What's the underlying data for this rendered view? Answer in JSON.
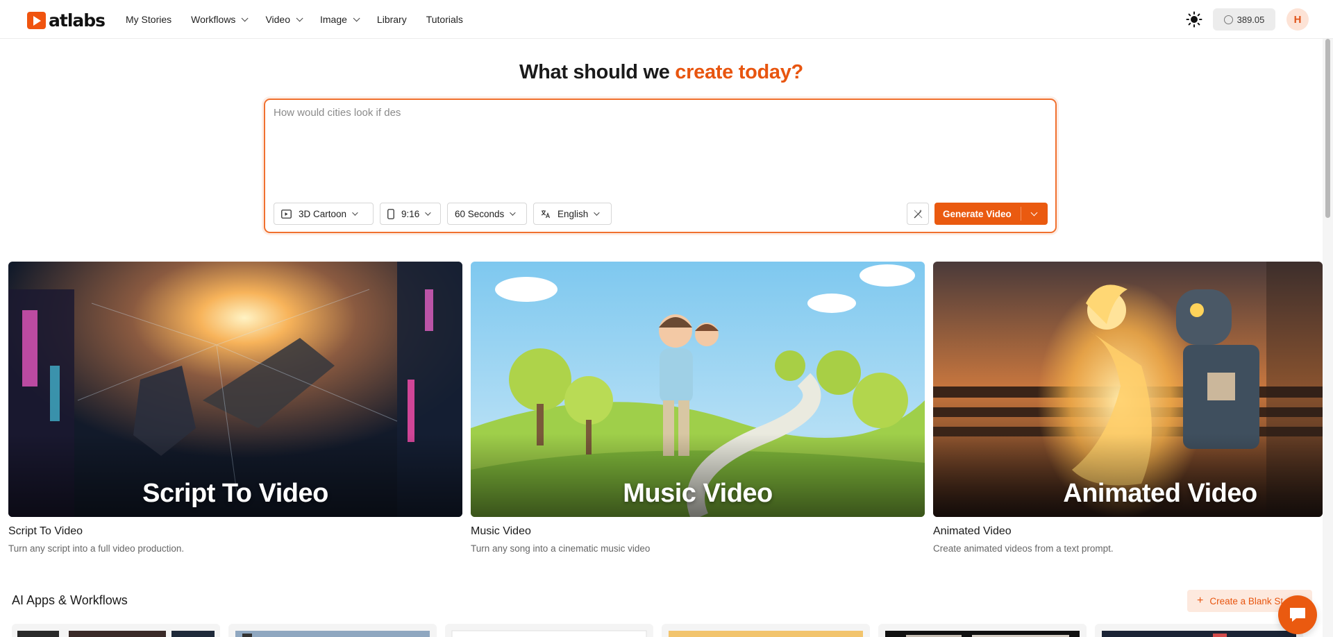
{
  "app": {
    "logo_text": "atlabs"
  },
  "nav": {
    "items": [
      {
        "label": "My Stories",
        "has_dropdown": false
      },
      {
        "label": "Workflows",
        "has_dropdown": true
      },
      {
        "label": "Video",
        "has_dropdown": true
      },
      {
        "label": "Image",
        "has_dropdown": true
      },
      {
        "label": "Library",
        "has_dropdown": false
      },
      {
        "label": "Tutorials",
        "has_dropdown": false
      }
    ]
  },
  "header": {
    "credits": "389.05",
    "avatar_initial": "H",
    "theme_icon": "sun-icon"
  },
  "hero": {
    "title_plain": "What should we ",
    "title_accent": "create today?",
    "prompt_placeholder": "How would cities look if des",
    "style_label": "3D Cartoon",
    "ratio_label": "9:16",
    "duration_label": "60 Seconds",
    "language_label": "English",
    "generate_label": "Generate Video"
  },
  "cards": [
    {
      "image_title": "Script To Video",
      "title": "Script To Video",
      "description": "Turn any script into a full video production."
    },
    {
      "image_title": "Music Video",
      "title": "Music Video",
      "description": "Turn any song into a cinematic music video"
    },
    {
      "image_title": "Animated Video",
      "title": "Animated Video",
      "description": "Create animated videos from a text prompt."
    }
  ],
  "workflows": {
    "title": "AI Apps & Workflows",
    "create_blank_label": "Create a Blank St"
  },
  "colors": {
    "accent": "#ea5a10",
    "accent_light": "#fde9de",
    "text": "#1f1f1f"
  }
}
